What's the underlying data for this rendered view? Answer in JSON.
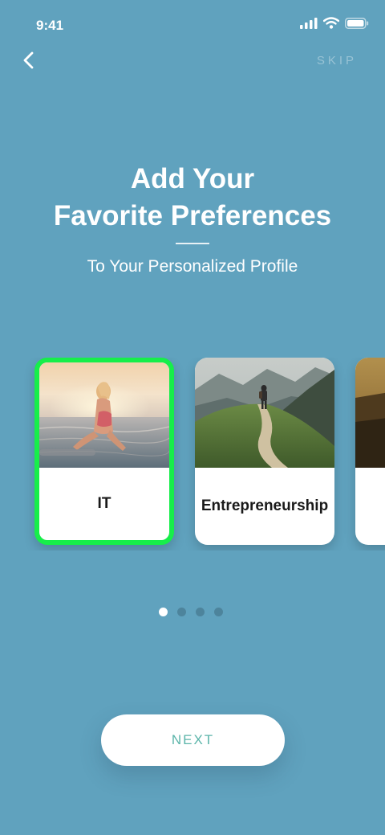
{
  "status_bar": {
    "time": "9:41"
  },
  "header": {
    "skip_label": "SKIP"
  },
  "intro": {
    "title_line1": "Add Your",
    "title_line2": "Favorite Preferences",
    "subtitle": "To Your Personalized Profile"
  },
  "cards": [
    {
      "label": "IT",
      "selected": true
    },
    {
      "label": "Entrepreneurship",
      "selected": false
    },
    {
      "label": "",
      "selected": false
    }
  ],
  "pagination": {
    "total": 4,
    "active": 1
  },
  "footer": {
    "next_label": "NEXT"
  },
  "colors": {
    "background": "#60a2be",
    "selected_border": "#17ee4a",
    "next_text": "#5cb5aa"
  }
}
